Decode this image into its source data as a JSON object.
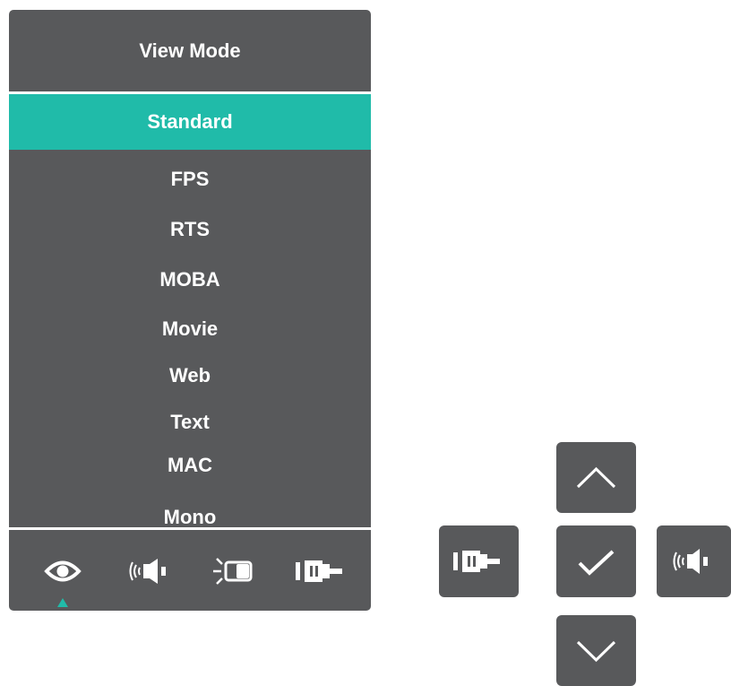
{
  "osd": {
    "title": "View Mode",
    "modes": [
      {
        "label": "Standard",
        "selected": true
      },
      {
        "label": "FPS",
        "selected": false
      },
      {
        "label": "RTS",
        "selected": false
      },
      {
        "label": "MOBA",
        "selected": false
      },
      {
        "label": "Movie",
        "selected": false
      },
      {
        "label": "Web",
        "selected": false
      },
      {
        "label": "Text",
        "selected": false
      },
      {
        "label": "MAC",
        "selected": false
      },
      {
        "label": "Mono",
        "selected": false
      }
    ],
    "bottom_icons": [
      "eye-icon",
      "audio-speaker-icon",
      "backlight-icon",
      "input-source-icon"
    ],
    "active_icon": "eye-icon"
  },
  "keys": {
    "left": "input-source-icon",
    "up": "chevron-up-icon",
    "center": "checkmark-icon",
    "right": "audio-speaker-icon",
    "down": "chevron-down-icon"
  },
  "colors": {
    "panel": "#58595b",
    "accent": "#20bba9",
    "text": "#ffffff"
  }
}
